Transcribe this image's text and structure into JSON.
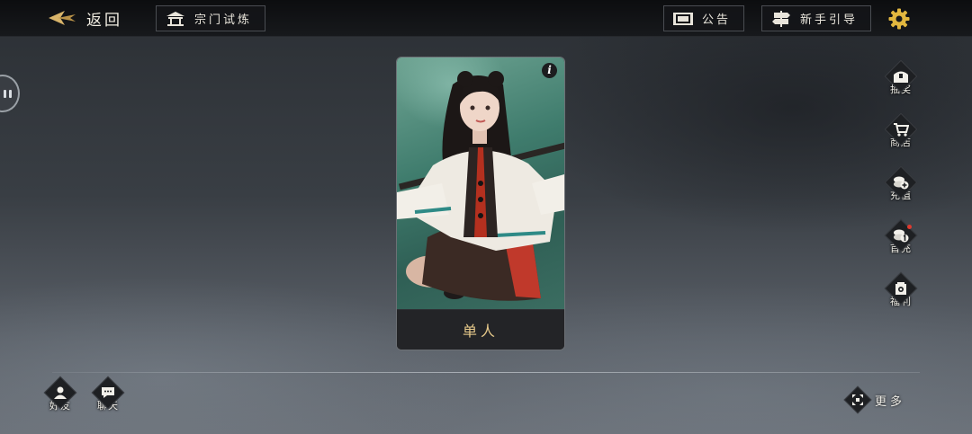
{
  "top_bar": {
    "back_label": "返回",
    "sect_trial_label": "宗门试炼",
    "notice_label": "公告",
    "guide_label": "新手引导"
  },
  "card": {
    "title": "单人"
  },
  "right_menu": [
    {
      "label": "抽奖",
      "icon": "treasure-chest-icon"
    },
    {
      "label": "商店",
      "icon": "shopping-cart-icon"
    },
    {
      "label": "充值",
      "icon": "coins-plus-icon"
    },
    {
      "label": "首充",
      "icon": "coins-one-icon",
      "badge": true
    },
    {
      "label": "福利",
      "icon": "gift-bag-icon"
    }
  ],
  "bottom": {
    "friends_label": "好友",
    "chat_label": "聊天",
    "more_label": "更多"
  },
  "colors": {
    "accent_gold": "#e6c98a",
    "topbar_bg": "#0c0d0f",
    "badge_red": "#e03a2f"
  }
}
